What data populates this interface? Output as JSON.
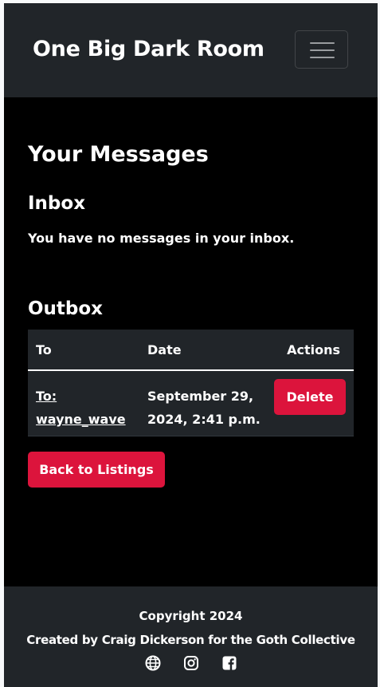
{
  "navbar": {
    "brand": "One Big Dark Room",
    "toggler_icon": "hamburger-menu-icon"
  },
  "page": {
    "title": "Your Messages"
  },
  "inbox": {
    "heading": "Inbox",
    "empty_message": "You have no messages in your inbox."
  },
  "outbox": {
    "heading": "Outbox",
    "columns": [
      "To",
      "Date",
      "Actions"
    ],
    "rows": [
      {
        "to": "To: wayne_wave",
        "date": "September 29, 2024, 2:41 p.m.",
        "action": "Delete"
      }
    ]
  },
  "back_button": "Back to Listings",
  "footer": {
    "copyright": "Copyright 2024",
    "credit": "Created by Craig Dickerson for the Goth Collective",
    "social_icons": [
      "globe-icon",
      "instagram-icon",
      "facebook-icon"
    ]
  },
  "colors": {
    "accent": "#dc143c",
    "navbar_bg": "#212529",
    "page_bg": "#000000"
  }
}
